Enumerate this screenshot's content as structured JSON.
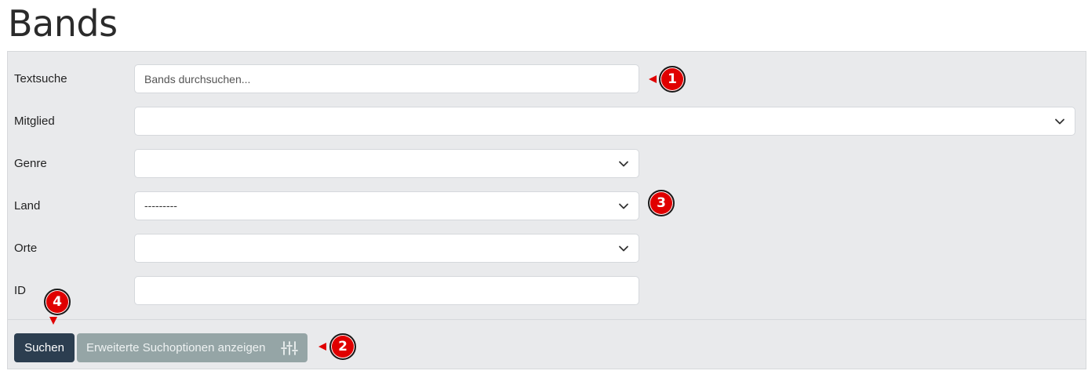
{
  "page": {
    "title": "Bands"
  },
  "form": {
    "textsearch": {
      "label": "Textsuche",
      "placeholder": "Bands durchsuchen...",
      "value": ""
    },
    "member": {
      "label": "Mitglied",
      "value": ""
    },
    "genre": {
      "label": "Genre",
      "value": ""
    },
    "country": {
      "label": "Land",
      "value": "---------"
    },
    "places": {
      "label": "Orte",
      "value": ""
    },
    "id": {
      "label": "ID",
      "value": ""
    }
  },
  "buttons": {
    "search": "Suchen",
    "advanced": "Erweiterte Suchoptionen anzeigen"
  },
  "icons": {
    "select_arrow": "chevron-down-icon",
    "advanced": "sliders-icon"
  },
  "markers": [
    "1",
    "2",
    "3",
    "4"
  ],
  "colors": {
    "panel_bg": "#e9eaec",
    "primary_button": "#2c3e50",
    "secondary_button": "#95a5a6",
    "marker": "#e00000"
  }
}
